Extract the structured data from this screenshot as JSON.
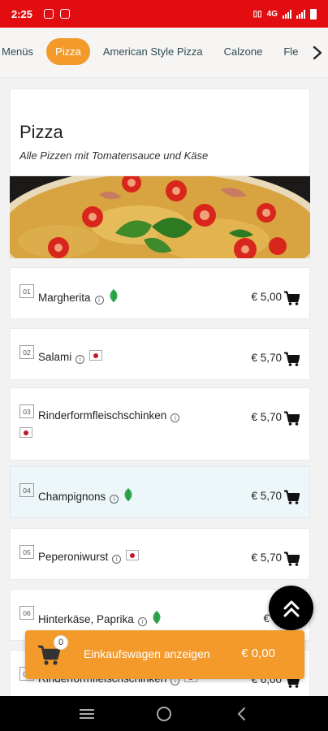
{
  "status_bar": {
    "time": "2:25",
    "network": "4G"
  },
  "tabs": {
    "items": [
      {
        "label": "Menüs",
        "active": false
      },
      {
        "label": "Pizza",
        "active": true
      },
      {
        "label": "American Style Pizza",
        "active": false
      },
      {
        "label": "Calzone",
        "active": false
      },
      {
        "label": "Fle",
        "active": false
      }
    ],
    "scroll_icon": "chevron-right-icon"
  },
  "category": {
    "title": "Pizza",
    "subtitle": "Alle Pizzen mit Tomatensauce und Käse"
  },
  "items": [
    {
      "number": "01",
      "name": "Margherita",
      "price": "€ 5,00",
      "badge": "leaf-icon",
      "highlight": false
    },
    {
      "number": "02",
      "name": "Salami",
      "price": "€ 5,70",
      "badge": "meat-icon",
      "highlight": false
    },
    {
      "number": "03",
      "name": "Rinderformfleischschinken",
      "price": "€ 5,70",
      "badge": "meat-icon",
      "highlight": false
    },
    {
      "number": "04",
      "name": "Champignons",
      "price": "€ 5,70",
      "badge": "leaf-icon",
      "highlight": true
    },
    {
      "number": "05",
      "name": "Peperoniwurst",
      "price": "€ 5,70",
      "badge": "meat-icon",
      "highlight": false
    },
    {
      "number": "06",
      "name": "Hinterkäse, Paprika",
      "price": "€ 6,",
      "badge": "leaf-icon",
      "highlight": false
    },
    {
      "number": "07",
      "name": "Rinderformfleischschinken",
      "price": "€ 6,00",
      "badge": "meat-icon",
      "highlight": false
    }
  ],
  "cart_bar": {
    "count": "0",
    "label": "Einkaufswagen anzeigen",
    "total": "€ 0,00"
  },
  "colors": {
    "status_bar": "#e10d11",
    "accent": "#f39a2b",
    "leaf": "#2fa84f",
    "meat": "#c2162b"
  }
}
